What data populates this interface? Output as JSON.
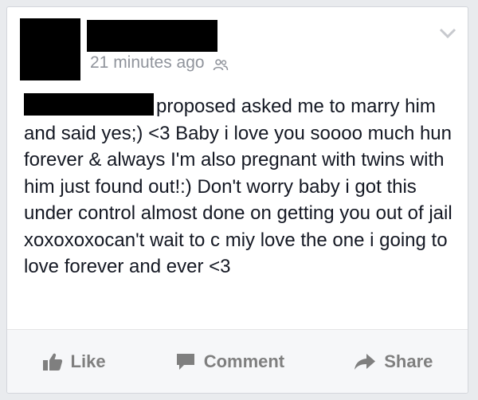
{
  "post": {
    "timestamp": "21 minutes ago",
    "audience_icon": "friends-icon",
    "text": "proposed asked me to marry him and said yes;) <3 Baby i love you soooo much hun forever & always I'm also pregnant with twins with him just found out!:) Don't worry baby i got this under control almost done on getting you out of jail xoxoxoxocan't wait to c miy love the one i going to love forever and ever <3"
  },
  "actions": {
    "like_label": "Like",
    "comment_label": "Comment",
    "share_label": "Share"
  },
  "colors": {
    "text": "#141823",
    "meta": "#90949c",
    "action": "#7f7f7f",
    "footer_bg": "#f6f7f9"
  }
}
